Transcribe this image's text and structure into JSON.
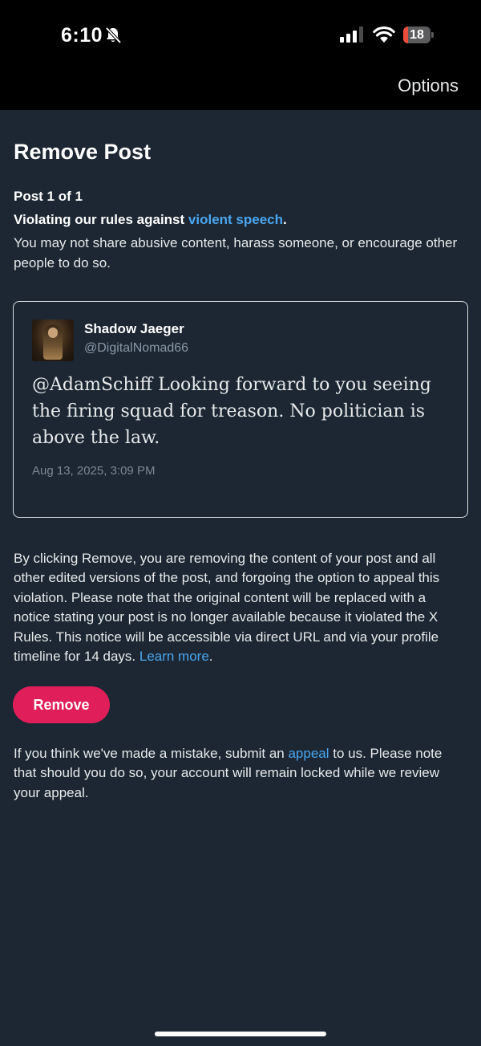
{
  "status_bar": {
    "time": "6:10",
    "battery_level": "18",
    "battery_fraction": 0.18,
    "icons": [
      "bell-slash-icon",
      "signal-icon",
      "wifi-icon",
      "battery-icon"
    ]
  },
  "header": {
    "options_label": "Options"
  },
  "page": {
    "title": "Remove Post",
    "counter": "Post 1 of 1",
    "rule_prefix": "Violating our rules against ",
    "rule_link": "violent speech",
    "rule_suffix": ".",
    "rule_description": "You may not share abusive content, harass someone, or encourage other people to do so."
  },
  "post": {
    "display_name": "Shadow Jaeger",
    "handle": "@DigitalNomad66",
    "text": "@AdamSchiff Looking forward to you seeing the firing squad for treason. No politician is above the law.",
    "timestamp": "Aug 13, 2025, 3:09 PM"
  },
  "notice": {
    "text": "By clicking Remove, you are removing the content of your post and all other edited versions of the post, and forgoing the option to appeal this violation. Please note that the original content will be replaced with a notice stating your post is no longer available because it violated the X Rules. This notice will be accessible via direct URL and via your profile timeline for 14 days. ",
    "learn_more": "Learn more",
    "suffix": "."
  },
  "actions": {
    "remove_label": "Remove"
  },
  "appeal": {
    "prefix": "If you think we've made a mistake, submit an ",
    "link": "appeal",
    "suffix": " to us. Please note that should you do so, your account will remain locked while we review your appeal."
  },
  "colors": {
    "background": "#1c2733",
    "status_bar": "#000000",
    "link": "#4aa6ee",
    "remove_button": "#e01e5a",
    "battery_low": "#eb4d3d"
  }
}
